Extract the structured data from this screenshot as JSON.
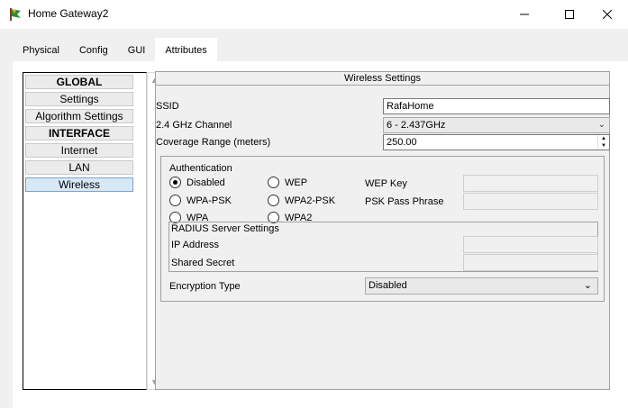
{
  "window": {
    "title": "Home Gateway2",
    "controls": {
      "minimize": "minimize-icon",
      "maximize": "maximize-icon",
      "close": "close-icon"
    }
  },
  "tabs": [
    {
      "label": "Physical",
      "active": false
    },
    {
      "label": "Config",
      "active": true
    },
    {
      "label": "GUI",
      "active": false
    },
    {
      "label": "Attributes",
      "active": false
    }
  ],
  "sidebar": {
    "items": [
      {
        "label": "GLOBAL",
        "type": "header"
      },
      {
        "label": "Settings",
        "type": "item"
      },
      {
        "label": "Algorithm Settings",
        "type": "item"
      },
      {
        "label": "INTERFACE",
        "type": "header"
      },
      {
        "label": "Internet",
        "type": "item"
      },
      {
        "label": "LAN",
        "type": "item"
      },
      {
        "label": "Wireless",
        "type": "item",
        "selected": true
      }
    ]
  },
  "wireless": {
    "title": "Wireless Settings",
    "ssid": {
      "label": "SSID",
      "value": "RafaHome"
    },
    "channel": {
      "label": "2.4 GHz Channel",
      "value": "6 - 2.437GHz"
    },
    "coverage": {
      "label": "Coverage Range (meters)",
      "value": "250.00"
    },
    "auth": {
      "title": "Authentication",
      "options": [
        {
          "label": "Disabled",
          "checked": true
        },
        {
          "label": "WEP",
          "checked": false
        },
        {
          "label": "WPA-PSK",
          "checked": false
        },
        {
          "label": "WPA2-PSK",
          "checked": false
        },
        {
          "label": "WPA",
          "checked": false
        },
        {
          "label": "WPA2",
          "checked": false
        }
      ],
      "wep_key_label": "WEP Key",
      "psk_label": "PSK Pass Phrase"
    },
    "radius": {
      "title": "RADIUS Server Settings",
      "ip_label": "IP Address",
      "secret_label": "Shared Secret"
    },
    "encryption": {
      "label": "Encryption Type",
      "value": "Disabled"
    }
  }
}
